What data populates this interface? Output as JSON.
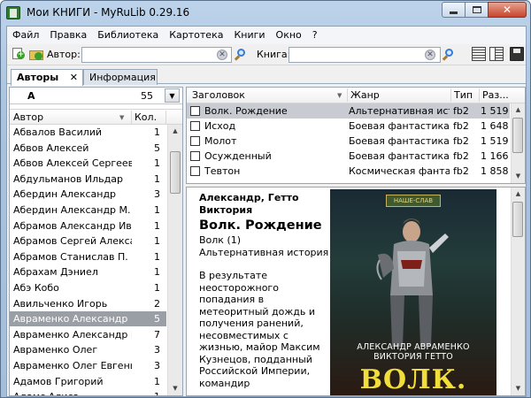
{
  "window": {
    "title": "Мои КНИГИ - MyRuLib 0.29.16"
  },
  "menu": [
    "Файл",
    "Правка",
    "Библиотека",
    "Картотека",
    "Книги",
    "Окно",
    "?"
  ],
  "toolbar": {
    "author_label": "Автор:",
    "author_value": "",
    "book_label": "Книга:",
    "book_value": ""
  },
  "tabs": [
    {
      "label": "Авторы"
    },
    {
      "label": "Информация"
    }
  ],
  "letter_filter": {
    "letter": "А",
    "count": "55"
  },
  "authors_table": {
    "columns": [
      "Автор",
      "Кол."
    ],
    "rows": [
      {
        "name": "Абвалов Василий",
        "count": "1"
      },
      {
        "name": "Абвов Алексей",
        "count": "5"
      },
      {
        "name": "Абвов Алексей Сергеевич",
        "count": "1"
      },
      {
        "name": "Абдульманов Ильдар",
        "count": "1"
      },
      {
        "name": "Абердин Александр",
        "count": "3"
      },
      {
        "name": "Абердин Александр М.",
        "count": "1"
      },
      {
        "name": "Абрамов Александр Иванов",
        "count": "1"
      },
      {
        "name": "Абрамов Сергей Александр",
        "count": "1"
      },
      {
        "name": "Абрамов Станислав П.",
        "count": "1"
      },
      {
        "name": "Абрахам Дэниел",
        "count": "1"
      },
      {
        "name": "Абэ Кобо",
        "count": "1"
      },
      {
        "name": "Авильченко Игорь",
        "count": "2"
      },
      {
        "name": "Авраменко Александр",
        "count": "5"
      },
      {
        "name": "Авраменко Александр Миха",
        "count": "7"
      },
      {
        "name": "Авраменко Олег",
        "count": "3"
      },
      {
        "name": "Авраменко Олег Евгеньеви",
        "count": "3"
      },
      {
        "name": "Адамов Григорий",
        "count": "1"
      },
      {
        "name": "Адамс Алиса",
        "count": "1"
      }
    ],
    "selected_index": 12
  },
  "books_table": {
    "columns": [
      "Заголовок",
      "Жанр",
      "Тип",
      "Раз..."
    ],
    "rows": [
      {
        "title": "Волк. Рождение",
        "genre": "Альтернативная истори",
        "type": "fb2",
        "size": "1 519"
      },
      {
        "title": "Исход",
        "genre": "Боевая фантастика",
        "type": "fb2",
        "size": "1 648"
      },
      {
        "title": "Молот",
        "genre": "Боевая фантастика",
        "type": "fb2",
        "size": "1 519"
      },
      {
        "title": "Осужденный",
        "genre": "Боевая фантастика",
        "type": "fb2",
        "size": "1 166"
      },
      {
        "title": "Тевтон",
        "genre": "Космическая фантасти",
        "type": "fb2",
        "size": "1 858"
      }
    ],
    "selected_index": 0
  },
  "book_info": {
    "authors": "Александр, Гетто Виктория",
    "title": "Волк. Рождение",
    "series": "Волк (1)",
    "genre": "Альтернативная история",
    "annotation": "В результате неосторожного попадания в метеоритный дождь и получения ранений, несовместимых с жизнью, майор Максим Кузнецов, подданный Российской Империи, командир"
  },
  "cover": {
    "badge": "НАШЕ-СЛАВ",
    "author_line1": "АЛЕКСАНДР АВРАМЕНКО",
    "author_line2": "ВИКТОРИЯ ГЕТТО",
    "series_title": "ВОЛК."
  }
}
